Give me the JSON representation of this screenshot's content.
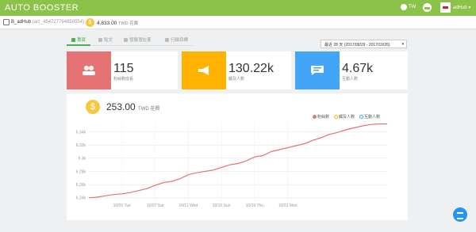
{
  "app": {
    "brand": "AUTO BOOSTER"
  },
  "topbar": {
    "language": "TW",
    "user": "adHub"
  },
  "account": {
    "name": "B_adHub",
    "id": "(act_454727794850554)",
    "balance": "4,833.00",
    "currency": "TWD 花費"
  },
  "tabs": [
    {
      "label": "專頁",
      "active": true
    },
    {
      "label": "貼文",
      "active": false
    },
    {
      "label": "發展潛在客",
      "active": false
    },
    {
      "label": "行銷目標",
      "active": false
    }
  ],
  "date_range": "最近 28 天 (2017/09/29 - 2017/10/26)",
  "cards": [
    {
      "value": "115",
      "label": "粉絲數成長",
      "color": "#e57373",
      "icon": "users-icon"
    },
    {
      "value": "130.22k",
      "label": "觸及人數",
      "color": "#ffb300",
      "icon": "megaphone-icon"
    },
    {
      "value": "4.67k",
      "label": "互動人數",
      "color": "#42a5f5",
      "icon": "chat-icon"
    }
  ],
  "spend": {
    "value": "253.00",
    "currency": "TWD 花費"
  },
  "legend": [
    {
      "label": "粉絲數",
      "color": "#e57373",
      "active": true
    },
    {
      "label": "觸及人數",
      "color": "#ffb300",
      "active": false
    },
    {
      "label": "互動人數",
      "color": "#42a5f5",
      "active": false
    }
  ],
  "chart_data": {
    "type": "line",
    "title": "",
    "xlabel": "",
    "ylabel": "",
    "ylim": [
      6.235,
      6.355
    ],
    "yticks": [
      6.24,
      6.26,
      6.28,
      6.3,
      6.32,
      6.34
    ],
    "ytick_labels": [
      "6.24k",
      "6.26k",
      "6.28k",
      "6.3k",
      "6.32k",
      "6.34k"
    ],
    "xtick_indices": [
      4,
      8,
      12,
      16,
      20,
      24
    ],
    "xtick_labels": [
      "10/03 Tue",
      "10/07 Sat",
      "10/11 Wed",
      "10/15 Sun",
      "10/19 Thu",
      "10/23 Mon"
    ],
    "series": [
      {
        "name": "粉絲數",
        "color": "#e57373",
        "values": [
          6.24,
          6.241,
          6.243,
          6.245,
          6.246,
          6.248,
          6.251,
          6.254,
          6.259,
          6.263,
          6.265,
          6.269,
          6.275,
          6.278,
          6.28,
          6.282,
          6.286,
          6.29,
          6.292,
          6.296,
          6.302,
          6.304,
          6.31,
          6.313,
          6.316,
          6.319,
          6.322,
          6.327,
          6.331,
          6.336,
          6.339,
          6.343,
          6.346,
          6.349,
          6.351,
          6.352,
          6.352
        ]
      }
    ]
  }
}
